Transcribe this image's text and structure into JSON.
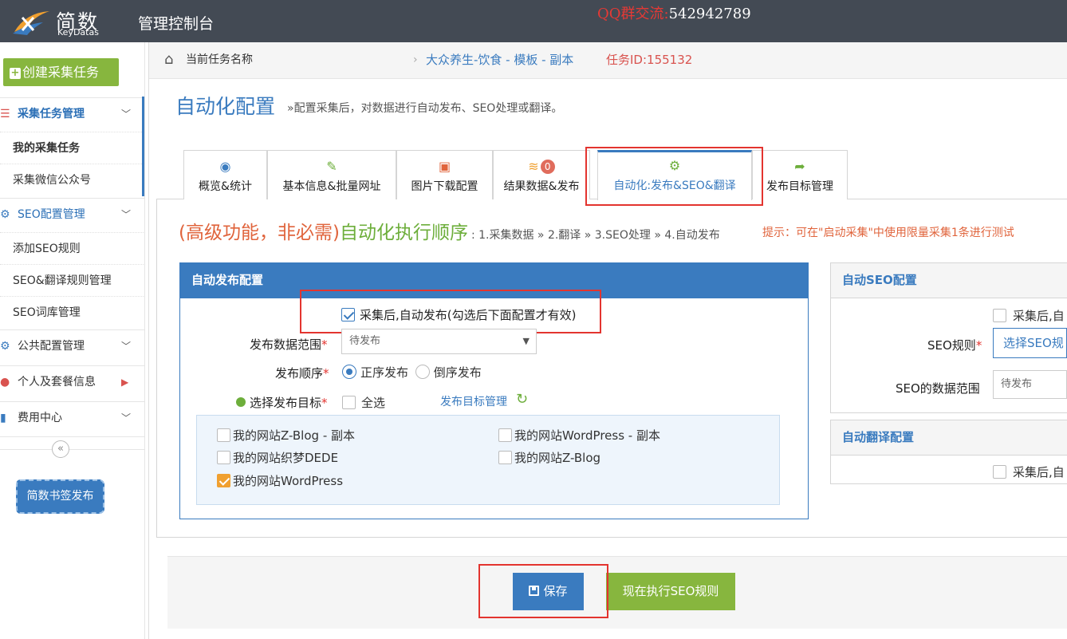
{
  "topbar": {
    "logo_cn": "简数",
    "logo_en": "KeyDatas",
    "app_title": "管理控制台",
    "qq_label": "QQ群交流:",
    "qq_number": "542942789"
  },
  "sidebar": {
    "create_task": "创建采集任务",
    "sections": [
      {
        "label": "采集任务管理",
        "icon": "list-icon"
      },
      {
        "label": "SEO配置管理",
        "icon": "gear-icon"
      },
      {
        "label": "公共配置管理",
        "icon": "gears-icon"
      },
      {
        "label": "个人及套餐信息",
        "icon": "user-icon"
      },
      {
        "label": "费用中心",
        "icon": "bar-chart-icon"
      }
    ],
    "items": [
      {
        "label": "我的采集任务"
      },
      {
        "label": "采集微信公众号"
      },
      {
        "label": "添加SEO规则"
      },
      {
        "label": "SEO&翻译规则管理"
      },
      {
        "label": "SEO词库管理"
      }
    ],
    "collapse_glyph": "«",
    "bookmark_button": "简数书签发布"
  },
  "breadcrumb": {
    "label": "当前任务名称",
    "separator": "›",
    "task_name": "大众养生-饮食 - 模板 - 副本",
    "task_id": "任务ID:155132"
  },
  "page": {
    "title": "自动化配置",
    "subtitle": "»配置采集后，对数据进行自动发布、SEO处理或翻译。"
  },
  "tabs": [
    {
      "label": "概览&统计",
      "icon": "dashboard-icon"
    },
    {
      "label": "基本信息&批量网址",
      "icon": "edit-icon"
    },
    {
      "label": "图片下载配置",
      "icon": "image-icon"
    },
    {
      "label": "结果数据&发布",
      "icon": "database-icon",
      "badge": "0"
    },
    {
      "label": "自动化:发布&SEO&翻译",
      "icon": "cogs-icon",
      "active": true
    },
    {
      "label": "发布目标管理",
      "icon": "share-icon"
    }
  ],
  "order": {
    "part_a": "(高级功能，非必需)",
    "part_b": "自动化执行顺序",
    "steps": ": 1.采集数据 » 2.翻译 » 3.SEO处理 » 4.自动发布",
    "tip": "提示：可在\"启动采集\"中使用限量采集1条进行测试"
  },
  "publish": {
    "heading": "自动发布配置",
    "auto_publish_label": "采集后,自动发布(勾选后下面配置才有效)",
    "auto_publish_checked": true,
    "range_label": "发布数据范围",
    "range_value": "待发布",
    "order_label": "发布顺序",
    "order_options": [
      "正序发布",
      "倒序发布"
    ],
    "order_selected": "正序发布",
    "target_label": "选择发布目标",
    "select_all": "全选",
    "target_manage_link": "发布目标管理",
    "targets": [
      {
        "label": "我的网站Z-Blog - 副本",
        "checked": false
      },
      {
        "label": "我的网站WordPress - 副本",
        "checked": false
      },
      {
        "label": "我的网站织梦DEDE",
        "checked": false
      },
      {
        "label": "我的网站Z-Blog",
        "checked": false
      },
      {
        "label": "我的网站WordPress",
        "checked": true
      }
    ],
    "required_mark": "*"
  },
  "seo": {
    "heading": "自动SEO配置",
    "auto_label": "采集后,自",
    "rule_label": "SEO规则",
    "rule_value": "选择SEO规",
    "range_label": "SEO的数据范围",
    "range_value": "待发布"
  },
  "translate": {
    "heading": "自动翻译配置",
    "auto_label": "采集后,自"
  },
  "footer": {
    "save": "保存",
    "run_seo": "现在执行SEO规则"
  },
  "colors": {
    "topbar": "#434a54",
    "primary": "#3a7bbf",
    "green": "#87b63e",
    "orange": "#e0643c",
    "highlight": "#e3342f"
  }
}
